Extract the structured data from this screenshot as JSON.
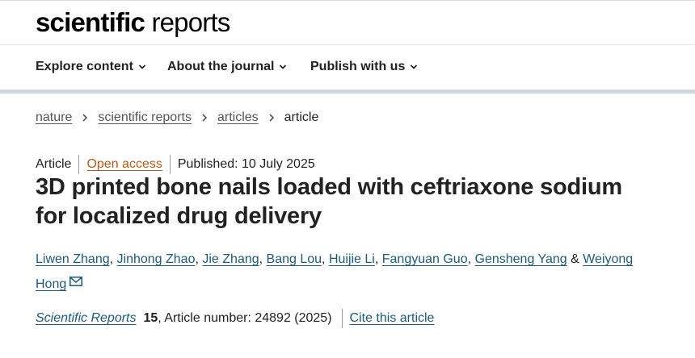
{
  "header": {
    "logo_bold": "scientific",
    "logo_light": "reports"
  },
  "nav": {
    "items": [
      {
        "label": "Explore content",
        "icon": "chevron-down-icon"
      },
      {
        "label": "About the journal",
        "icon": "chevron-down-icon"
      },
      {
        "label": "Publish with us",
        "icon": "chevron-down-icon"
      }
    ]
  },
  "breadcrumb": {
    "items": [
      "nature",
      "scientific reports",
      "articles"
    ],
    "current": "article",
    "separator_icon": "chevron-right-icon"
  },
  "article": {
    "type": "Article",
    "access": "Open access",
    "published": "Published: 10 July 2025",
    "title": "3D printed bone nails loaded with ceftriaxone sodium for localized drug delivery",
    "authors": [
      "Liwen Zhang",
      "Jinhong Zhao",
      "Jie Zhang",
      "Bang Lou",
      "Huijie Li",
      "Fangyuan Guo",
      "Gensheng Yang",
      "Weiyong Hong"
    ],
    "author_separator": ", ",
    "author_last_join": " & ",
    "corresponding_icon": "mail-icon",
    "citation": {
      "journal": "Scientific Reports",
      "volume": "15",
      "article_number": ", Article number: 24892 (2025)",
      "cite_label": "Cite this article"
    }
  },
  "colors": {
    "link": "#1d5a7a",
    "open_access": "#b75b1e",
    "nav_rule": "#ced6dc",
    "text": "#222222"
  }
}
